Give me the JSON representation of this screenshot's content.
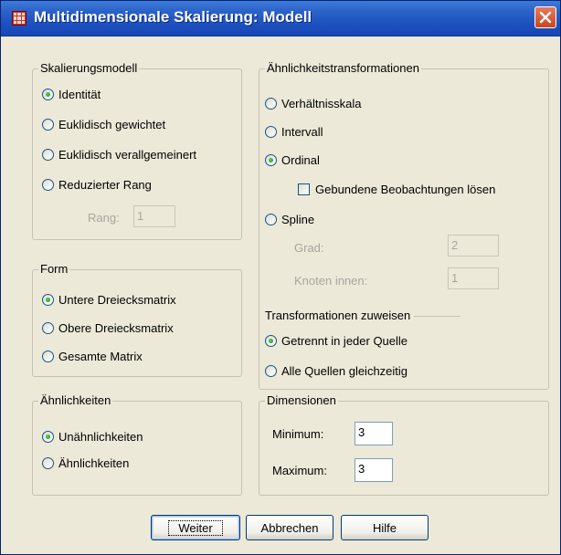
{
  "window": {
    "title": "Multidimensionale Skalierung: Modell",
    "icon": "spss-grid-icon",
    "close_icon": "close-icon"
  },
  "skalierungsmodell": {
    "title": "Skalierungsmodell",
    "options": [
      {
        "label": "Identität",
        "selected": true
      },
      {
        "label": "Euklidisch gewichtet",
        "selected": false
      },
      {
        "label": "Euklidisch verallgemeinert",
        "selected": false
      },
      {
        "label": "Reduzierter Rang",
        "selected": false
      }
    ],
    "rang_label": "Rang:",
    "rang_value": "1"
  },
  "form": {
    "title": "Form",
    "options": [
      {
        "label": "Untere Dreiecksmatrix",
        "selected": true
      },
      {
        "label": "Obere Dreiecksmatrix",
        "selected": false
      },
      {
        "label": "Gesamte Matrix",
        "selected": false
      }
    ]
  },
  "aehnlichkeiten": {
    "title": "Ähnlichkeiten",
    "options": [
      {
        "label": "Unähnlichkeiten",
        "selected": true
      },
      {
        "label": "Ähnlichkeiten",
        "selected": false
      }
    ]
  },
  "transformationen": {
    "title": "Ähnlichkeitstransformationen",
    "options": [
      {
        "label": "Verhältnisskala",
        "selected": false
      },
      {
        "label": "Intervall",
        "selected": false
      },
      {
        "label": "Ordinal",
        "selected": true
      },
      {
        "label": "Spline",
        "selected": false
      }
    ],
    "ties_checkbox": {
      "label": "Gebundene Beobachtungen lösen",
      "checked": false
    },
    "grad_label": "Grad:",
    "grad_value": "2",
    "knoten_label": "Knoten innen:",
    "knoten_value": "1",
    "zuweisen_title": "Transformationen zuweisen",
    "zuweisen_options": [
      {
        "label": "Getrennt in jeder Quelle",
        "selected": true
      },
      {
        "label": "Alle Quellen gleichzeitig",
        "selected": false
      }
    ]
  },
  "dimensionen": {
    "title": "Dimensionen",
    "minimum_label": "Minimum:",
    "minimum_value": "3",
    "maximum_label": "Maximum:",
    "maximum_value": "3"
  },
  "buttons": {
    "weiter": "Weiter",
    "abbrechen": "Abbrechen",
    "hilfe": "Hilfe"
  },
  "colors": {
    "titlebar": "#2b62c9",
    "dialog_bg": "#ece9d8",
    "radio_selected": "#21a121",
    "close_button": "#c8461f"
  }
}
